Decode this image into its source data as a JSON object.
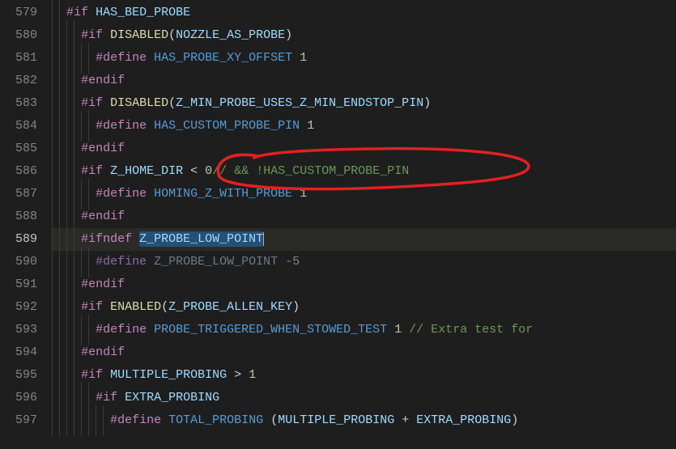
{
  "gutter": {
    "start": 579,
    "end": 597
  },
  "modifiedLine": 586,
  "currentLine": 589,
  "tokens": {
    "hash": "#",
    "if": "if",
    "endif": "endif",
    "ifndef": "ifndef",
    "define": "define",
    "space": " ",
    "HAS_BED_PROBE": "HAS_BED_PROBE",
    "DISABLED": "DISABLED",
    "ENABLED": "ENABLED",
    "NOZZLE_AS_PROBE": "NOZZLE_AS_PROBE",
    "HAS_PROBE_XY_OFFSET": "HAS_PROBE_XY_OFFSET",
    "Z_MIN_PROBE_USES_Z_MIN_ENDSTOP_PIN": "Z_MIN_PROBE_USES_Z_MIN_ENDSTOP_PIN",
    "HAS_CUSTOM_PROBE_PIN": "HAS_CUSTOM_PROBE_PIN",
    "Z_HOME_DIR": "Z_HOME_DIR",
    "HOMING_Z_WITH_PROBE": "HOMING_Z_WITH_PROBE",
    "Z_PROBE_LOW_POINT": "Z_PROBE_LOW_POINT",
    "Z_PROBE_ALLEN_KEY": "Z_PROBE_ALLEN_KEY",
    "PROBE_TRIGGERED_WHEN_STOWED_TEST": "PROBE_TRIGGERED_WHEN_STOWED_TEST",
    "MULTIPLE_PROBING": "MULTIPLE_PROBING",
    "EXTRA_PROBING": "EXTRA_PROBING",
    "TOTAL_PROBING": "TOTAL_PROBING",
    "one": "1",
    "zero": "0",
    "neg5": "-5",
    "lt": "<",
    "gt": ">",
    "lp": "(",
    "rp": ")",
    "plus": " + ",
    "comment586": "// && !HAS_CUSTOM_PROBE_PIN",
    "comment593": "// Extra test for"
  },
  "annotation": {
    "color": "#e52020"
  }
}
